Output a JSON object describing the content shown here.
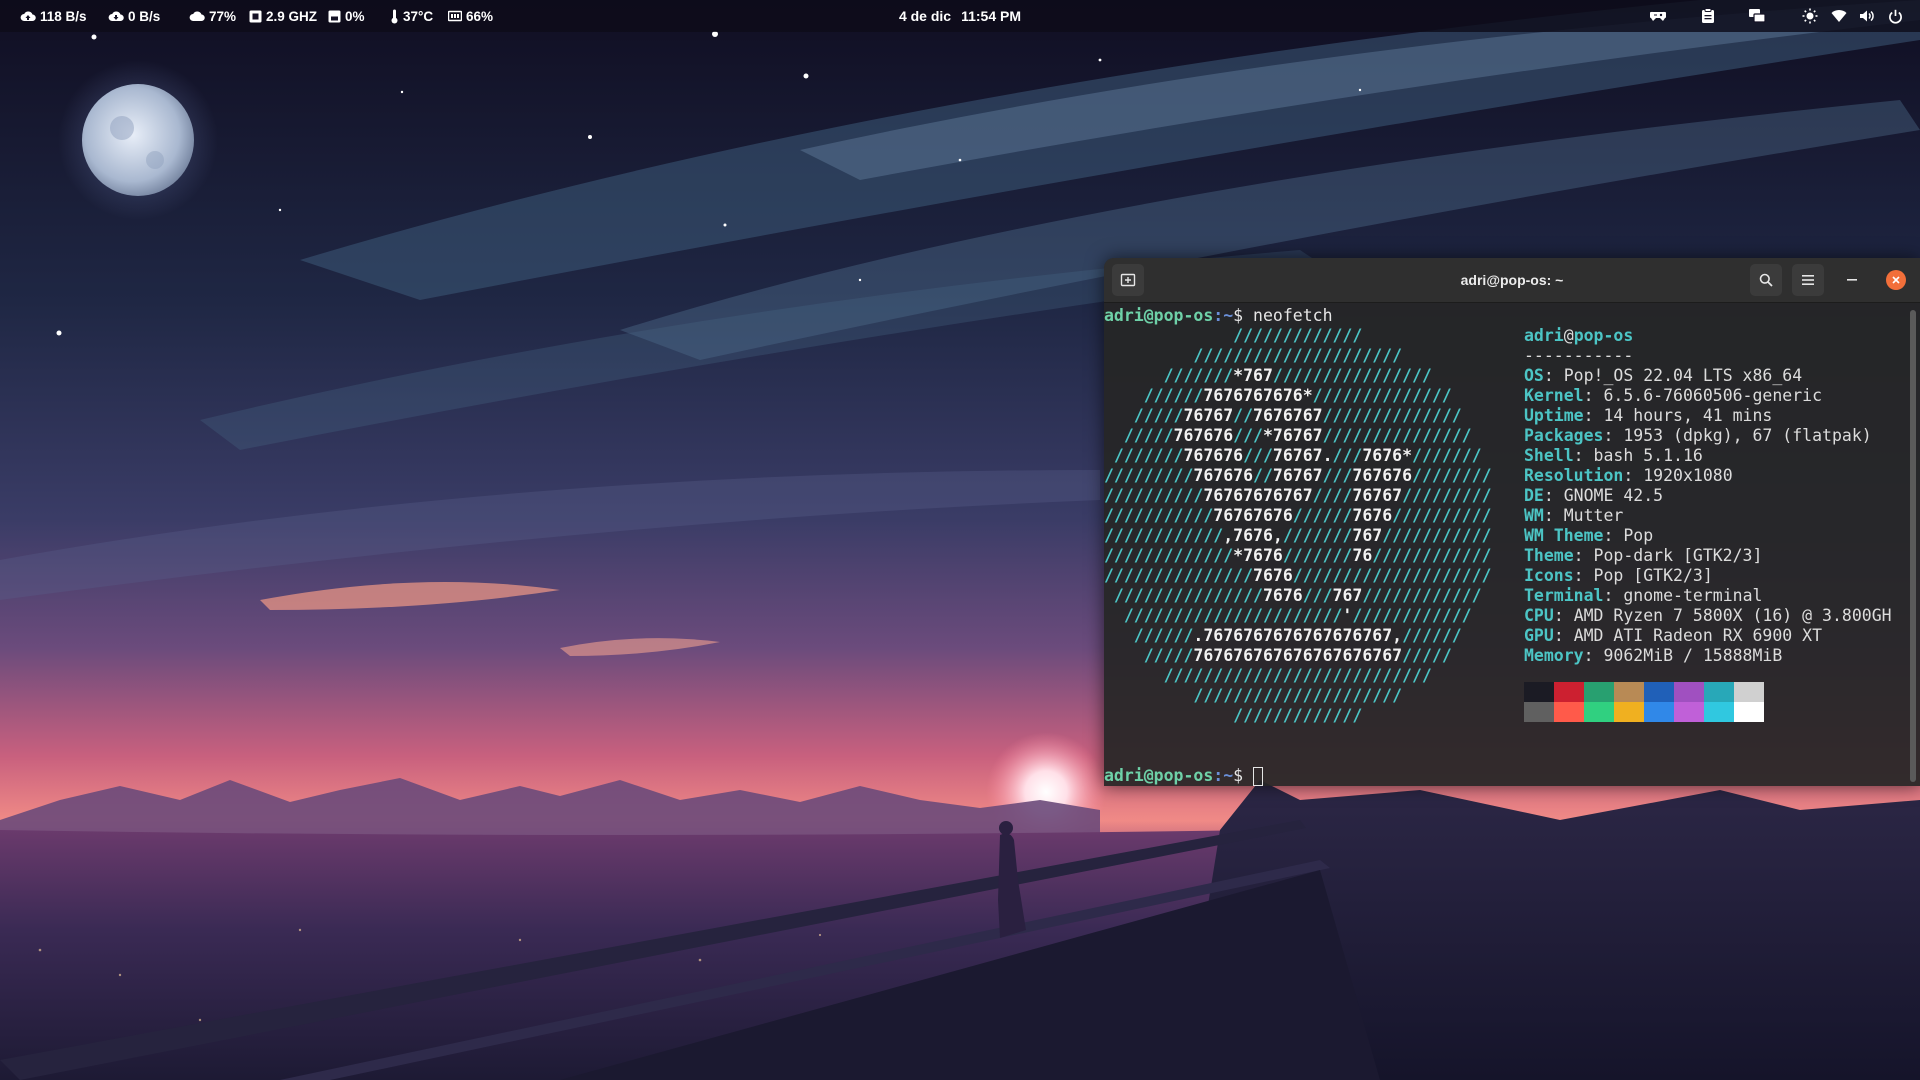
{
  "topbar": {
    "stats": [
      {
        "icon": "cloud-upload-icon",
        "value": "118 B/s"
      },
      {
        "icon": "cloud-download-icon",
        "value": "0 B/s"
      },
      {
        "icon": "cloud-icon",
        "value": "77%"
      },
      {
        "icon": "cpu-icon",
        "value": "2.9 GHZ"
      },
      {
        "icon": "disk-icon",
        "value": "0%"
      },
      {
        "icon": "thermometer-icon",
        "value": "37°C"
      },
      {
        "icon": "memory-icon",
        "value": "66%"
      }
    ],
    "date": "4 de dic",
    "time": "11:54 PM",
    "tray_icons": [
      "game-controller-icon",
      "clipboard-icon",
      "screens-icon",
      "brightness-icon",
      "wifi-icon",
      "volume-icon",
      "power-icon"
    ]
  },
  "terminal": {
    "title": "adri@pop-os: ~",
    "prompt": {
      "user": "adri@pop-os",
      "path": ":~",
      "symbol": "$"
    },
    "command": "neofetch",
    "logo_lines": [
      "             /////////////",
      "         /////////////////////",
      "      ///////*767////////////////",
      "    //////7676767676*//////////////",
      "   /////76767//7676767//////////////",
      "  /////767676///*76767///////////////",
      " ///////767676///76767.///7676*///////",
      "/////////767676//76767///767676////////",
      "//////////76767676767////76767/////////",
      "///////////76767676//////7676//////////",
      "////////////,7676,///////767///////////",
      "/////////////*7676///////76////////////",
      "///////////////7676////////////////////",
      " ///////////////7676///767////////////",
      "  //////////////////////'////////////",
      "   //////.7676767676767676767,//////",
      "    /////767676767676767676767/////",
      "      ///////////////////////////",
      "         /////////////////////",
      "             /////////////"
    ],
    "info_header": {
      "user": "adri",
      "at": "@",
      "host": "pop-os",
      "separator": "-----------"
    },
    "info": [
      {
        "key": "OS",
        "value": "Pop!_OS 22.04 LTS x86_64"
      },
      {
        "key": "Kernel",
        "value": "6.5.6-76060506-generic"
      },
      {
        "key": "Uptime",
        "value": "14 hours, 41 mins"
      },
      {
        "key": "Packages",
        "value": "1953 (dpkg), 67 (flatpak)"
      },
      {
        "key": "Shell",
        "value": "bash 5.1.16"
      },
      {
        "key": "Resolution",
        "value": "1920x1080"
      },
      {
        "key": "DE",
        "value": "GNOME 42.5"
      },
      {
        "key": "WM",
        "value": "Mutter"
      },
      {
        "key": "WM Theme",
        "value": "Pop"
      },
      {
        "key": "Theme",
        "value": "Pop-dark [GTK2/3]"
      },
      {
        "key": "Icons",
        "value": "Pop [GTK2/3]"
      },
      {
        "key": "Terminal",
        "value": "gnome-terminal"
      },
      {
        "key": "CPU",
        "value": "AMD Ryzen 7 5800X (16) @ 3.800GH"
      },
      {
        "key": "GPU",
        "value": "AMD ATI Radeon RX 6900 XT"
      },
      {
        "key": "Memory",
        "value": "9062MiB / 15888MiB"
      }
    ],
    "palette_top": [
      "#1b1b24",
      "#cc2030",
      "#28a070",
      "#b88a55",
      "#2060b8",
      "#a050c0",
      "#28a8b8",
      "#d0d0d0"
    ],
    "palette_bottom": [
      "#606060",
      "#ff5a4a",
      "#30d080",
      "#f0b020",
      "#3088e8",
      "#c060d8",
      "#30c8e0",
      "#ffffff"
    ]
  }
}
